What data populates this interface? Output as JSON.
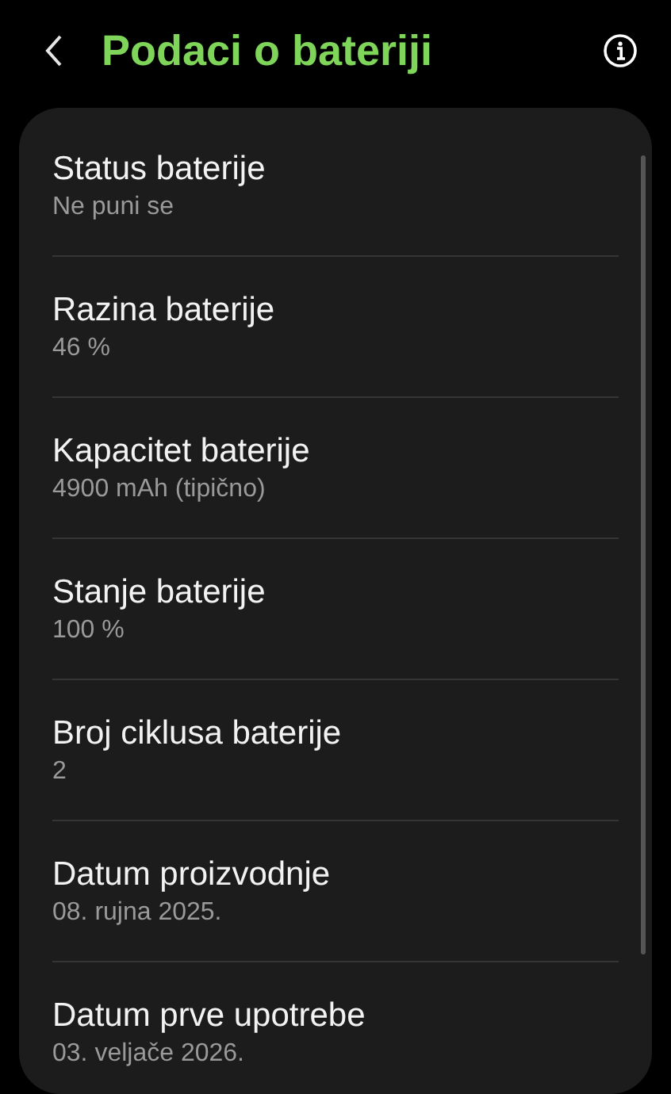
{
  "header": {
    "title": "Podaci o bateriji"
  },
  "items": [
    {
      "title": "Status baterije",
      "value": "Ne puni se"
    },
    {
      "title": "Razina baterije",
      "value": "46 %"
    },
    {
      "title": "Kapacitet baterije",
      "value": "4900 mAh (tipično)"
    },
    {
      "title": "Stanje baterije",
      "value": "100 %"
    },
    {
      "title": "Broj ciklusa baterije",
      "value": "2"
    },
    {
      "title": "Datum proizvodnje",
      "value": "08. rujna 2025."
    },
    {
      "title": "Datum prve upotrebe",
      "value": "03. veljače 2026."
    }
  ]
}
